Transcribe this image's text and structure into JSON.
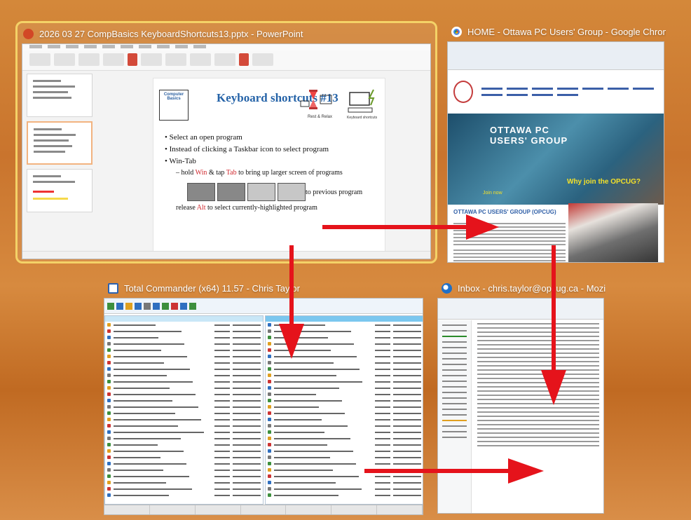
{
  "windows": {
    "powerpoint": {
      "title": "2026 03 27 CompBasics KeyboardShortcuts13.pptx - PowerPoint",
      "icon": "powerpoint-icon",
      "accent": "#d24726",
      "slide": {
        "logo_text": "Computer Basics",
        "title": "Keyboard shortcuts #13",
        "bullets": [
          "Select an open program",
          "Instead of clicking a Taskbar icon to select program",
          "Win-Tab"
        ],
        "sub_bullet_1": {
          "pre": "hold ",
          "key1": "Win",
          "mid": " & tap ",
          "key2": "Tab",
          "post": " to bring up larger screen of programs"
        },
        "sub_bullet_2": {
          "pre": "release ",
          "key": "Alt",
          "post": " to select currently-highlighted program",
          "line1_tail": "to previous program"
        },
        "image_caption_1": "Rest & Relax",
        "image_caption_2": "Keyboard shortcuts"
      }
    },
    "chrome": {
      "title": "HOME - Ottawa PC Users' Group - Google Chrome",
      "icon": "chrome-icon",
      "hero_title": "OTTAWA PC USERS' GROUP",
      "hero_join": "Why join the OPCUG?",
      "hero_sub": "Join now",
      "section_title": "OTTAWA PC USERS' GROUP (OPCUG)"
    },
    "total_commander": {
      "title": "Total Commander (x64) 11.57 - Chris Taylor",
      "icon": "total-commander-icon"
    },
    "thunderbird": {
      "title": "Inbox - chris.taylor@opcug.ca - Mozilla Thunder...",
      "icon": "thunderbird-icon"
    }
  },
  "colors": {
    "selected_border": "#f4d267",
    "arrow": "#e5131b",
    "background": "#cf7e33"
  }
}
